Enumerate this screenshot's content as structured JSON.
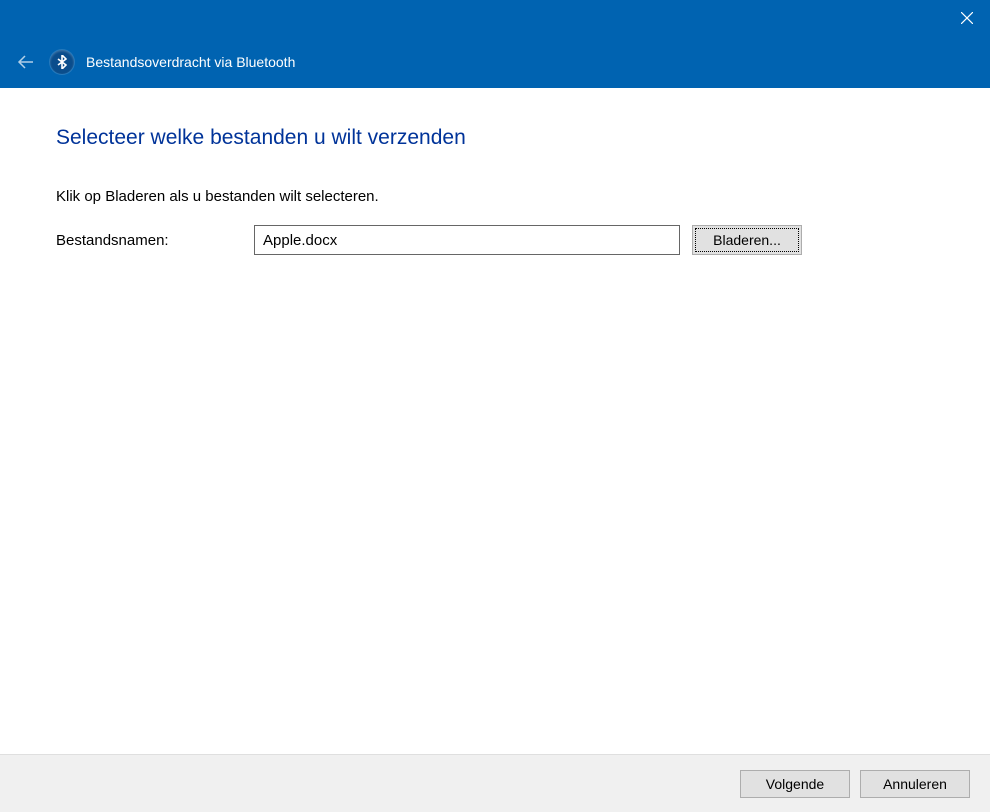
{
  "window": {
    "title": "Bestandsoverdracht via Bluetooth"
  },
  "content": {
    "heading": "Selecteer welke bestanden u wilt verzenden",
    "instruction": "Klik op Bladeren als u bestanden wilt selecteren.",
    "file_label": "Bestandsnamen:",
    "file_value": "Apple.docx",
    "browse_label": "Bladeren..."
  },
  "footer": {
    "next_label": "Volgende",
    "cancel_label": "Annuleren"
  }
}
